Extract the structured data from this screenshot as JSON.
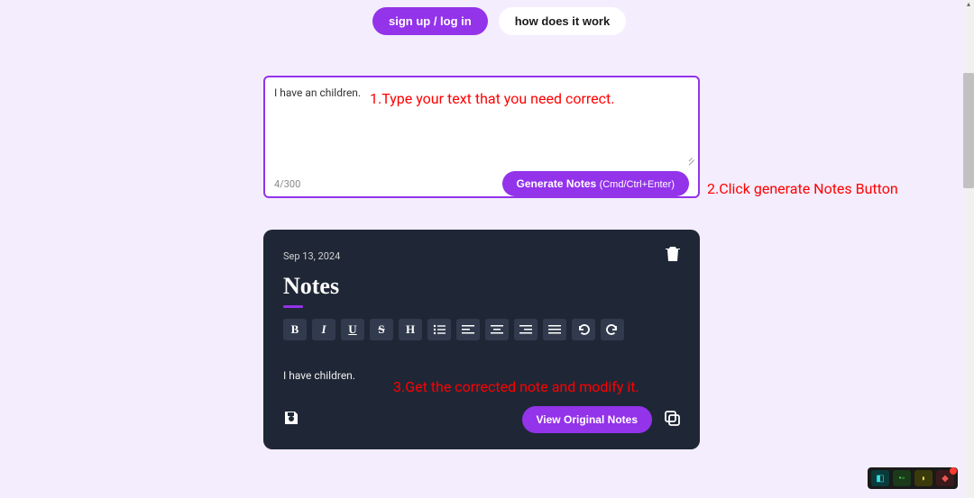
{
  "header": {
    "signup_label": "sign up / log in",
    "how_label": "how does it work"
  },
  "input": {
    "text": "I have an children.",
    "char_count": "4/300",
    "generate_label": "Generate Notes",
    "generate_shortcut": "(Cmd/Ctrl+Enter)"
  },
  "annotations": {
    "step1": "1.Type your text that you need correct.",
    "step2": "2.Click generate Notes Button",
    "step3": "3.Get the corrected note and modify it."
  },
  "note": {
    "date": "Sep 13, 2024",
    "title": "Notes",
    "body": "I have children.",
    "view_original_label": "View Original Notes"
  },
  "toolbar": {
    "bold": "B",
    "italic": "I",
    "underline": "U",
    "strike": "S",
    "heading": "H"
  }
}
